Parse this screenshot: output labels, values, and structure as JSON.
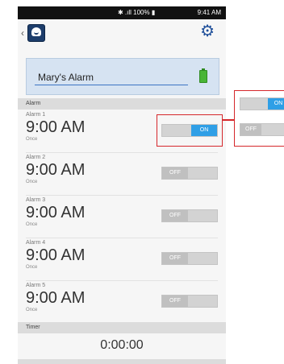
{
  "status_bar": {
    "icons": "✱ .ıll 100% ▮",
    "time": "9:41 AM"
  },
  "app_bar": {
    "back_icon": "chevron-left-icon",
    "app_icon": "app-logo-icon",
    "settings_icon": "gear-icon"
  },
  "profile": {
    "name": "Mary's Alarm",
    "battery": "battery-full-icon",
    "battery_color": "#49b536"
  },
  "alarm_section": {
    "title": "Alarm"
  },
  "alarms": [
    {
      "label": "Alarm 1",
      "time": "9:00 AM",
      "repeat": "Once",
      "state": "ON"
    },
    {
      "label": "Alarm 2",
      "time": "9:00 AM",
      "repeat": "Once",
      "state": "OFF"
    },
    {
      "label": "Alarm 3",
      "time": "9:00 AM",
      "repeat": "Once",
      "state": "OFF"
    },
    {
      "label": "Alarm 4",
      "time": "9:00 AM",
      "repeat": "Once",
      "state": "OFF"
    },
    {
      "label": "Alarm 5",
      "time": "9:00 AM",
      "repeat": "Once",
      "state": "OFF"
    }
  ],
  "timer_section": {
    "title": "Timer",
    "value": "0:00:00"
  },
  "callout": {
    "on_label": "ON",
    "off_label": "OFF"
  },
  "colors": {
    "accent": "#2f9fe6",
    "highlight": "#d5272b",
    "header": "#1f4f9a"
  }
}
